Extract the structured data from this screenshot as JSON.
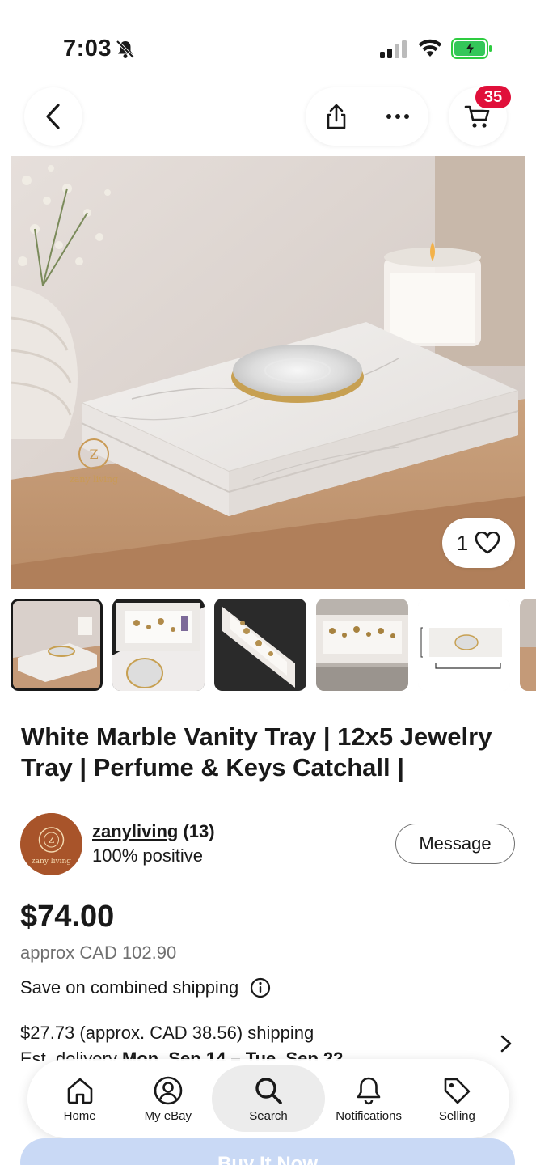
{
  "status_bar": {
    "time": "7:03"
  },
  "nav": {
    "cart_count": "35",
    "icons": [
      "back-chevron",
      "share",
      "more-dots",
      "cart"
    ]
  },
  "hero": {
    "watermark": "zany living",
    "favorite_count": "1"
  },
  "listing": {
    "title": "White Marble Vanity Tray | 12x5 Jewelry Tray | Perfume & Keys Catchall |",
    "thumbnails_count_visible": 6
  },
  "seller": {
    "name": "zanyliving",
    "feedback": "(13)",
    "positive": "100% positive",
    "message_label": "Message",
    "avatar_text": "zany living"
  },
  "pricing": {
    "price": "$74.00",
    "approx": "approx CAD 102.90",
    "combined_shipping": "Save on combined shipping",
    "shipping": "$27.73 (approx. CAD 38.56) shipping",
    "est_prefix": "Est. delivery",
    "est_dates": "Mon, Sep 14 – Tue, Sep 22"
  },
  "tab_bar": {
    "tabs": [
      {
        "label": "Home",
        "icon": "home-icon"
      },
      {
        "label": "My eBay",
        "icon": "user-icon"
      },
      {
        "label": "Search",
        "icon": "search-icon",
        "active": true
      },
      {
        "label": "Notifications",
        "icon": "bell-icon"
      },
      {
        "label": "Selling",
        "icon": "tag-icon"
      }
    ]
  },
  "buy_button": {
    "label": "Buy It Now"
  },
  "colors": {
    "badge": "#e0103a",
    "text": "#191919",
    "muted": "#707070",
    "buy": "#3665f3"
  }
}
